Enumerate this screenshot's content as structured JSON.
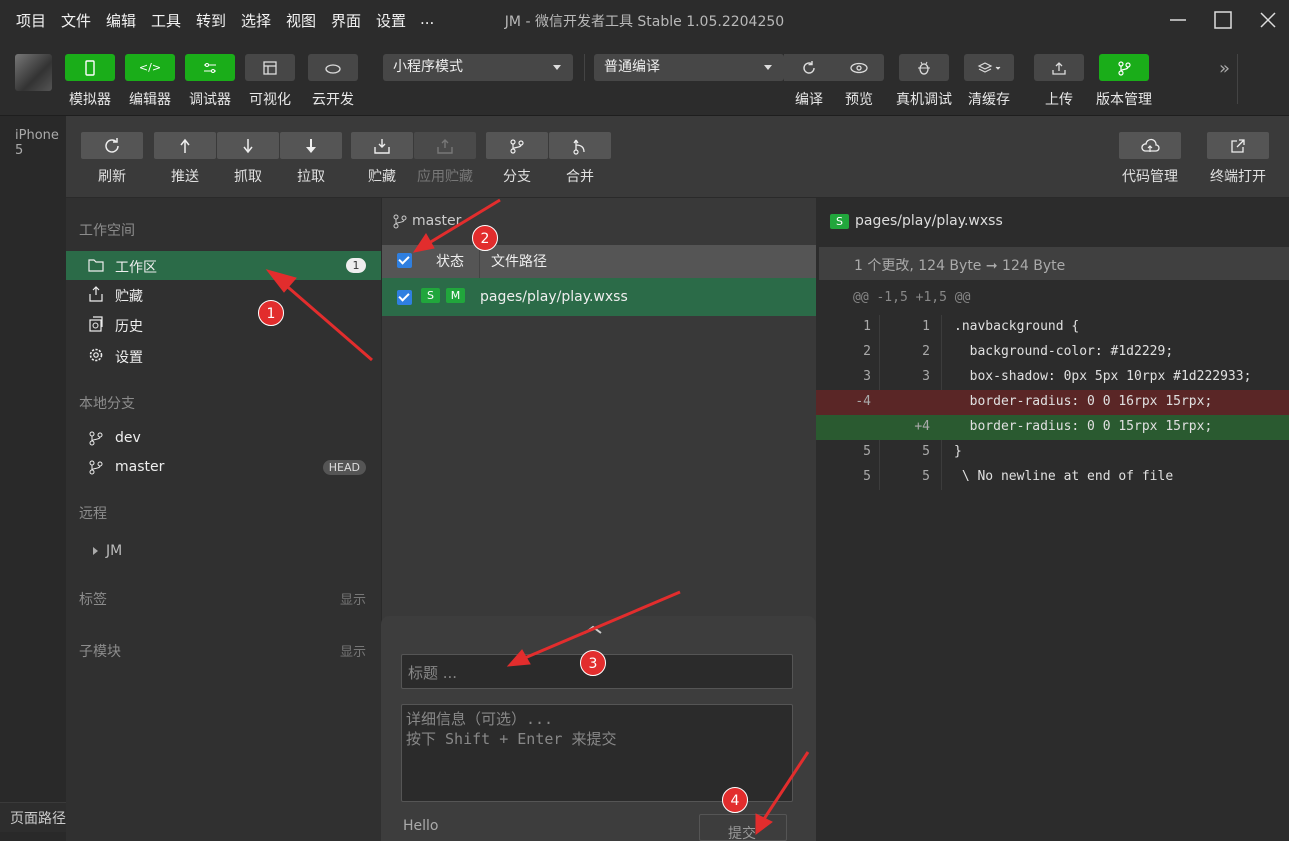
{
  "menu": [
    "项目",
    "文件",
    "编辑",
    "工具",
    "转到",
    "选择",
    "视图",
    "界面",
    "设置",
    "..."
  ],
  "window_title": "JM - 微信开发者工具 Stable 1.05.2204250",
  "toolbar": {
    "simulator": "模拟器",
    "editor": "编辑器",
    "debugger": "调试器",
    "visual": "可视化",
    "cloud": "云开发",
    "mode": "小程序模式",
    "compile_mode": "普通编译",
    "compile": "编译",
    "preview": "预览",
    "real_debug": "真机调试",
    "clear_cache": "清缓存",
    "upload": "上传",
    "version": "版本管理"
  },
  "device": "iPhone 5",
  "page_path": "页面路径",
  "git_toolbar": {
    "refresh": "刷新",
    "push": "推送",
    "fetch": "抓取",
    "pull": "拉取",
    "stash": "贮藏",
    "apply_stash": "应用贮藏",
    "branch": "分支",
    "merge": "合并",
    "code_mgmt": "代码管理",
    "terminal": "终端打开"
  },
  "sidebar": {
    "workspace_title": "工作空间",
    "workspace": "工作区",
    "workspace_count": "1",
    "stash": "贮藏",
    "history": "历史",
    "settings": "设置",
    "local_branches": "本地分支",
    "dev": "dev",
    "master": "master",
    "head": "HEAD",
    "remote": "远程",
    "remote_jm": "JM",
    "tags": "标签",
    "tags_show": "显示",
    "submodules": "子模块",
    "sub_show": "显示"
  },
  "files": {
    "branch": "master",
    "col_status": "状态",
    "col_path": "文件路径",
    "row_path": "pages/play/play.wxss",
    "row_tag1": "S",
    "row_tag2": "M"
  },
  "diff": {
    "file_tag": "S",
    "file": "pages/play/play.wxss",
    "summary": "1 个更改, 124 Byte ➞ 124 Byte",
    "hunk": "@@ -1,5 +1,5 @@",
    "lines": [
      {
        "a": "1",
        "b": "1",
        "code": ".navbackground {",
        "kind": "ctx"
      },
      {
        "a": "2",
        "b": "2",
        "code": "  background-color: #1d2229;",
        "kind": "ctx"
      },
      {
        "a": "3",
        "b": "3",
        "code": "  box-shadow: 0px 5px 10rpx #1d222933;",
        "kind": "ctx"
      },
      {
        "a": "-4",
        "b": "",
        "code": "  border-radius: 0 0 16rpx 15rpx;",
        "kind": "del"
      },
      {
        "a": "",
        "b": "+4",
        "code": "  border-radius: 0 0 15rpx 15rpx;",
        "kind": "add"
      },
      {
        "a": "5",
        "b": "5",
        "code": "}",
        "kind": "ctx"
      },
      {
        "a": "5",
        "b": "5",
        "code": " \\ No newline at end of file",
        "kind": "ctx"
      }
    ]
  },
  "commit": {
    "title_placeholder": "标题 ...",
    "detail_placeholder": "详细信息（可选）...\n按下 Shift + Enter 来提交",
    "author": "Hello",
    "submit": "提交"
  },
  "markers": [
    "1",
    "2",
    "3",
    "4"
  ]
}
